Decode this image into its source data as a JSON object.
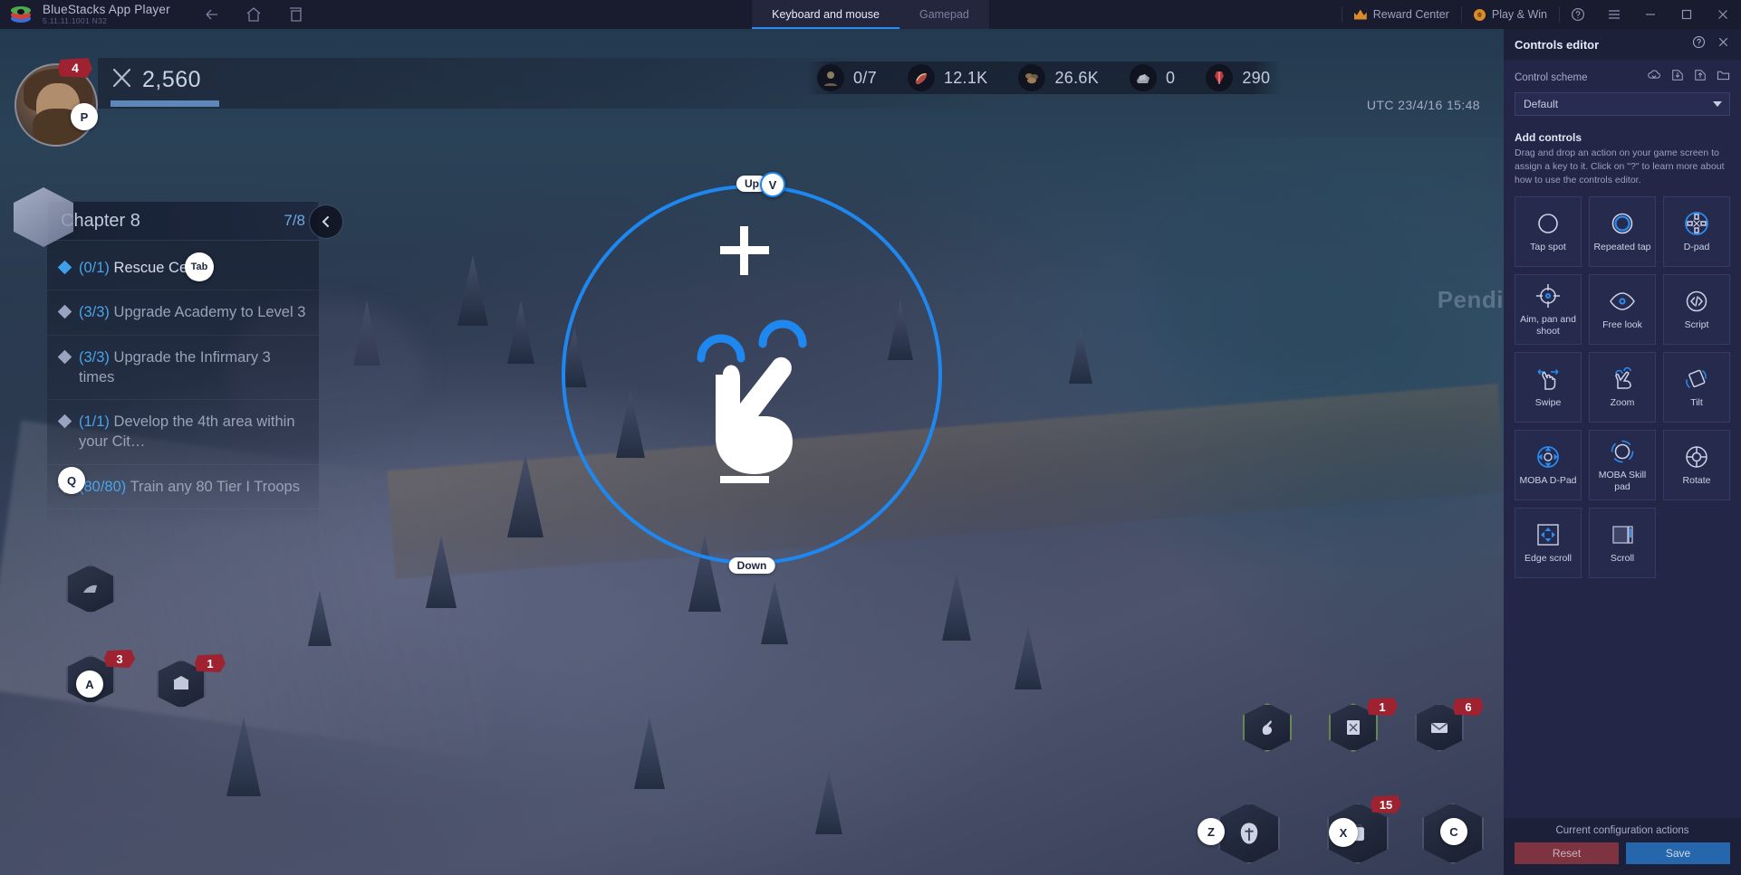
{
  "titlebar": {
    "app_name": "BlueStacks App Player",
    "version": "5.11.11.1001  N32",
    "nav": [
      {
        "name": "back-icon",
        "label": "Back"
      },
      {
        "name": "home-icon",
        "label": "Home"
      },
      {
        "name": "multi-instance-icon",
        "label": "Multi-instance"
      }
    ],
    "tabs": [
      {
        "label": "Keyboard and mouse",
        "active": true
      },
      {
        "label": "Gamepad",
        "active": false
      }
    ],
    "reward_center": "Reward Center",
    "play_win": "Play & Win",
    "help_icon": "help-icon",
    "menu_icon": "hamburger-menu-icon",
    "minimize": "minimize-icon",
    "maximize": "maximize-icon",
    "close": "close-icon"
  },
  "game": {
    "player": {
      "level_badge": "4",
      "key_hint": "P",
      "power_value": "2,560",
      "power_progress_percent": 62
    },
    "resources": [
      {
        "icon": "commander-icon",
        "value": "0/7"
      },
      {
        "icon": "meat-icon",
        "value": "12.1K"
      },
      {
        "icon": "wood-icon",
        "value": "26.6K"
      },
      {
        "icon": "stone-icon",
        "value": "0"
      },
      {
        "icon": "gold-icon",
        "value": "290"
      }
    ],
    "clock": "UTC 23/4/16 15:48",
    "pending_label": "Pendi",
    "quest": {
      "title": "Chapter 8",
      "progress": "7/8",
      "collapse_icon": "chevron-left-icon",
      "key_hint": "Tab",
      "items": [
        {
          "count": "(0/1)",
          "text": "Rescue Cecia",
          "active": true
        },
        {
          "count": "(3/3)",
          "text": "Upgrade Academy to Level 3",
          "active": false
        },
        {
          "count": "(3/3)",
          "text": "Upgrade the Infirmary 3 times",
          "active": false
        },
        {
          "count": "(1/1)",
          "text": "Develop the 4th area within your Cit…",
          "active": false
        },
        {
          "count": "(80/80)",
          "text": "Train any 80 Tier I Troops",
          "active": false
        }
      ]
    },
    "left_buttons": [
      {
        "name": "ability-q",
        "key": "Q",
        "badge": ""
      },
      {
        "name": "ability-a",
        "key": "A",
        "badge": "3"
      },
      {
        "name": "ability-build",
        "key": "",
        "badge": "1"
      }
    ],
    "right_buttons": [
      {
        "name": "gather-button",
        "key": "",
        "badge": ""
      },
      {
        "name": "research-button",
        "key": "",
        "badge": "1"
      },
      {
        "name": "mail-button",
        "key": "",
        "badge": "6"
      },
      {
        "name": "troops-button",
        "key": "Z",
        "badge": ""
      },
      {
        "name": "bag-button",
        "key": "X",
        "badge": "15"
      },
      {
        "name": "more-button",
        "key": "C",
        "badge": ""
      }
    ],
    "zoom_control": {
      "label_up": "Up",
      "label_down": "Down",
      "key_hint": "V",
      "plus": "+",
      "minus": "−",
      "ring_color": "#1e88f0"
    }
  },
  "panel": {
    "title": "Controls editor",
    "help_icon": "help-icon",
    "close_icon": "close-icon",
    "scheme_label": "Control scheme",
    "scheme_icons": [
      {
        "name": "cloud-sync-icon"
      },
      {
        "name": "import-icon"
      },
      {
        "name": "export-icon"
      },
      {
        "name": "folder-icon"
      }
    ],
    "scheme_value": "Default",
    "add_controls_title": "Add controls",
    "add_controls_desc": "Drag and drop an action on your game screen to assign a key to it. Click on \"?\" to learn more about how to use the controls editor.",
    "controls": [
      {
        "label": "Tap spot",
        "icon": "tap-spot-icon",
        "highlight": false
      },
      {
        "label": "Repeated tap",
        "icon": "repeated-tap-icon",
        "highlight": true
      },
      {
        "label": "D-pad",
        "icon": "dpad-icon",
        "highlight": true
      },
      {
        "label": "Aim, pan and shoot",
        "icon": "aim-pan-shoot-icon",
        "highlight": false
      },
      {
        "label": "Free look",
        "icon": "free-look-icon",
        "highlight": true
      },
      {
        "label": "Script",
        "icon": "script-icon",
        "highlight": false
      },
      {
        "label": "Swipe",
        "icon": "swipe-icon",
        "highlight": true
      },
      {
        "label": "Zoom",
        "icon": "zoom-icon",
        "highlight": true
      },
      {
        "label": "Tilt",
        "icon": "tilt-icon",
        "highlight": true
      },
      {
        "label": "MOBA D-Pad",
        "icon": "moba-dpad-icon",
        "highlight": true
      },
      {
        "label": "MOBA Skill pad",
        "icon": "moba-skill-pad-icon",
        "highlight": true
      },
      {
        "label": "Rotate",
        "icon": "rotate-icon",
        "highlight": false
      },
      {
        "label": "Edge scroll",
        "icon": "edge-scroll-icon",
        "highlight": true
      },
      {
        "label": "Scroll",
        "icon": "scroll-icon",
        "highlight": false
      }
    ],
    "footer_label": "Current configuration actions",
    "reset_label": "Reset",
    "save_label": "Save",
    "colors": {
      "reset": "#7e3340",
      "save": "#2566ad",
      "accent": "#2b8cf0"
    }
  }
}
